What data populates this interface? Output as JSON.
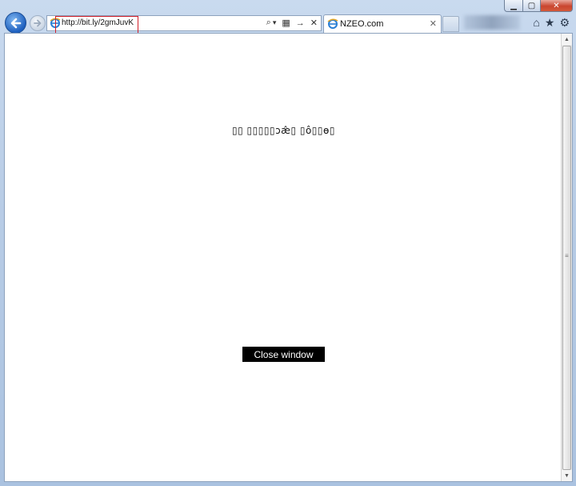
{
  "window": {
    "caption": {
      "minimize": "▁",
      "maximize": "▢",
      "close": "✕"
    }
  },
  "toolbar": {
    "back_icon": "back-arrow-icon",
    "forward_icon": "forward-arrow-icon",
    "address": {
      "url": "http://bit.ly/2gmJuvK",
      "search_glyph": "⌕",
      "dropdown_glyph": "▾",
      "compat_glyph": "▦",
      "go_glyph": "→",
      "stop_glyph": "✕"
    },
    "tab": {
      "label": "NZEO.com",
      "close": "✕"
    },
    "right_icons": {
      "home": "⌂",
      "favorites": "★",
      "tools": "⚙"
    }
  },
  "page": {
    "garbled_text": "▯▯ ▯▯▯▯▯ɔæ̂▯ ▯ô▯▯ɵ▯",
    "close_button": "Close window"
  },
  "colors": {
    "address_highlight": "#d21f2b",
    "close_button_bg": "#000000",
    "close_button_text": "#ffffff"
  }
}
